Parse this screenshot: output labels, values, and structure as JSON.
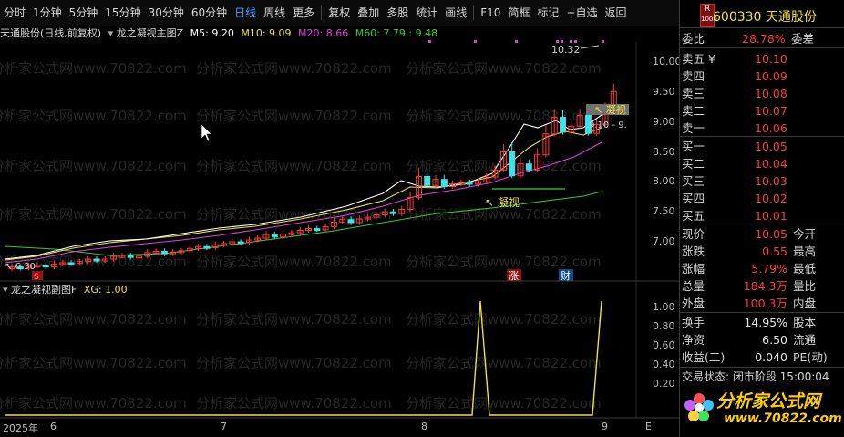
{
  "toolbar": {
    "items": [
      "分时",
      "1分钟",
      "5分钟",
      "15分钟",
      "30分钟",
      "60分钟",
      "日线",
      "周线",
      "更多",
      "复权",
      "叠加",
      "多股",
      "统计",
      "画线",
      "F10",
      "简框",
      "标记",
      "+自选",
      "返回"
    ],
    "active": "日线"
  },
  "legend_main": {
    "stock": "天通股份",
    "mode": "(日线,前复权)",
    "indicator": "龙之凝视主图Z",
    "ma5": "M5: 9.20",
    "ma10": "M10: 9.09",
    "ma20": "M20: 8.66",
    "ma60": "M60: 7.79 : 9.48"
  },
  "legend_sub": {
    "indicator": "龙之凝视副图F",
    "xg": "XG: 1.00"
  },
  "axis_main": [
    "10.00",
    "9.50",
    "9.00",
    "8.50",
    "8.00",
    "7.50",
    "7.00"
  ],
  "axis_sub": [
    "1.00",
    "0.80",
    "0.60",
    "0.40",
    "0.20"
  ],
  "annotations": {
    "high": "10.32",
    "low": "6.30",
    "ning_shi_1": "凝视",
    "ning_shi_2": "凝视",
    "range_label": "9.10 - 9.",
    "marker_s": "S",
    "marker_zhang": "涨",
    "marker_cai": "财"
  },
  "x_axis": [
    "2025年",
    "6",
    "7",
    "8",
    "9"
  ],
  "x_axis_end": "E",
  "watermark": "分析家公式网www.70822.com",
  "panel": {
    "badge_r": "R",
    "badge_num": "1000",
    "code": "600330",
    "name": "天通股份",
    "weibi_label": "委比",
    "weibi": "28.78%",
    "weicha_label": "委差",
    "sells": [
      {
        "label": "卖五 ¥",
        "price": "10.10"
      },
      {
        "label": "卖四",
        "price": "10.09"
      },
      {
        "label": "卖三",
        "price": "10.08"
      },
      {
        "label": "卖二",
        "price": "10.07"
      },
      {
        "label": "卖一",
        "price": "10.06"
      }
    ],
    "buys": [
      {
        "label": "买一",
        "price": "10.05"
      },
      {
        "label": "买二",
        "price": "10.04"
      },
      {
        "label": "买三",
        "price": "10.03"
      },
      {
        "label": "买四",
        "price": "10.02"
      },
      {
        "label": "买五",
        "price": "10.01"
      }
    ],
    "stats": [
      {
        "label": "现价",
        "value": "10.05",
        "label2": "今开"
      },
      {
        "label": "涨跌",
        "value": "0.55",
        "label2": "最高"
      },
      {
        "label": "涨幅",
        "value": "5.79%",
        "label2": "最低"
      },
      {
        "label": "总量",
        "value": "184.3万",
        "label2": "量比"
      },
      {
        "label": "外盘",
        "value": "100.3万",
        "label2": "内盘"
      }
    ],
    "stats2": [
      {
        "label": "换手",
        "value": "14.95%",
        "label2": "股本"
      },
      {
        "label": "净资",
        "value": "6.50",
        "label2": "流通"
      },
      {
        "label": "收益(二)",
        "value": "0.040",
        "label2": "PE(动)"
      }
    ],
    "status": "交易状态: 闭市阶段 15:00:04",
    "logo_text": "分析家公式网",
    "logo_url": "www.70822.com"
  },
  "colors": {
    "up": "#ff3b3b",
    "down": "#40e0e8",
    "ma5": "#ffffff",
    "ma10": "#f0e040",
    "ma20": "#e040e0",
    "ma60": "#30d030",
    "xg": "#f0e040",
    "active_tab": "#4aa3ff"
  }
}
